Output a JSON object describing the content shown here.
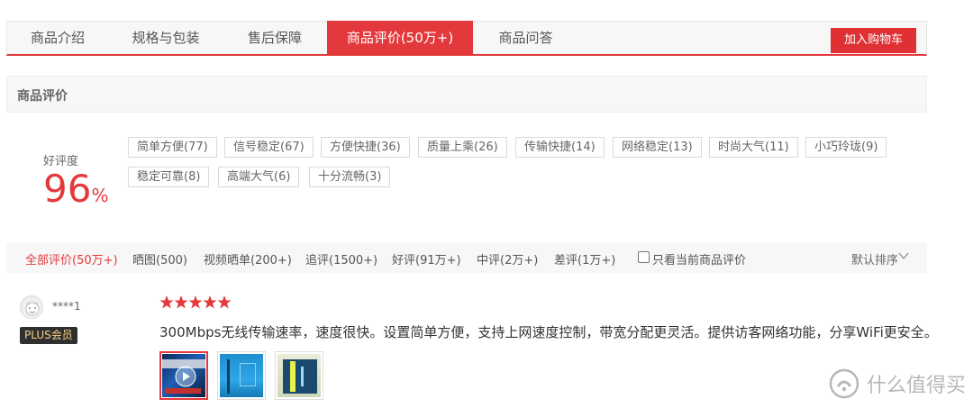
{
  "tabs": [
    {
      "label": "商品介绍",
      "active": false
    },
    {
      "label": "规格与包装",
      "active": false
    },
    {
      "label": "售后保障",
      "active": false
    },
    {
      "label": "商品评价(50万+)",
      "active": true
    },
    {
      "label": "商品问答",
      "active": false
    }
  ],
  "cart_button": "加入购物车",
  "section_title": "商品评价",
  "rating": {
    "label": "好评度",
    "value": "96",
    "unit": "%"
  },
  "tags": [
    "简单方便(77)",
    "信号稳定(67)",
    "方便快捷(36)",
    "质量上乘(26)",
    "传输快捷(14)",
    "网络稳定(13)",
    "时尚大气(11)",
    "小巧玲珑(9)",
    "稳定可靠(8)",
    "高端大气(6)",
    "十分流畅(3)"
  ],
  "filters": [
    {
      "label": "全部评价(50万+)",
      "active": true
    },
    {
      "label": "晒图(500)",
      "active": false
    },
    {
      "label": "视频晒单(200+)",
      "active": false
    },
    {
      "label": "追评(1500+)",
      "active": false
    },
    {
      "label": "好评(91万+)",
      "active": false
    },
    {
      "label": "中评(2万+)",
      "active": false
    },
    {
      "label": "差评(1万+)",
      "active": false
    }
  ],
  "only_current_label": "只看当前商品评价",
  "sort_label": "默认排序",
  "review": {
    "username": "****1",
    "badge": "PLUS会员",
    "stars": 5,
    "text": "300Mbps无线传输速率，速度很快。设置简单方便，支持上网速度控制，带宽分配更灵活。提供访客网络功能，分享WiFi更安全。"
  },
  "watermark": "什么值得买",
  "colors": {
    "accent": "#e4393c",
    "star": "#e4393c"
  }
}
